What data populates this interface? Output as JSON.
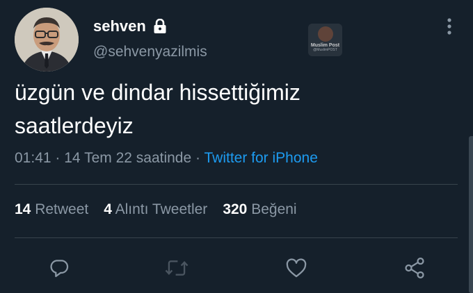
{
  "tweet": {
    "display_name": "sehven",
    "handle": "@sehvenyazilmis",
    "protected_icon": "lock-icon",
    "text": "üzgün ve dindar hissettiğimiz\nsaatlerdeyiz",
    "time": "01:41",
    "date": "14 Tem 22 saatinde",
    "source": "Twitter for iPhone",
    "separator": "·"
  },
  "watermark": {
    "title": "Muslim Post",
    "subtitle": "@MuslimPOST"
  },
  "stats": [
    {
      "count": "14",
      "label": "Retweet"
    },
    {
      "count": "4",
      "label": "Alıntı Tweetler"
    },
    {
      "count": "320",
      "label": "Beğeni"
    }
  ],
  "actions": [
    "reply-icon",
    "retweet-icon",
    "like-icon",
    "share-icon"
  ],
  "colors": {
    "background": "#15202b",
    "text_primary": "#ffffff",
    "text_secondary": "#8b98a5",
    "link": "#1d9bf0",
    "divider": "#38444d"
  }
}
